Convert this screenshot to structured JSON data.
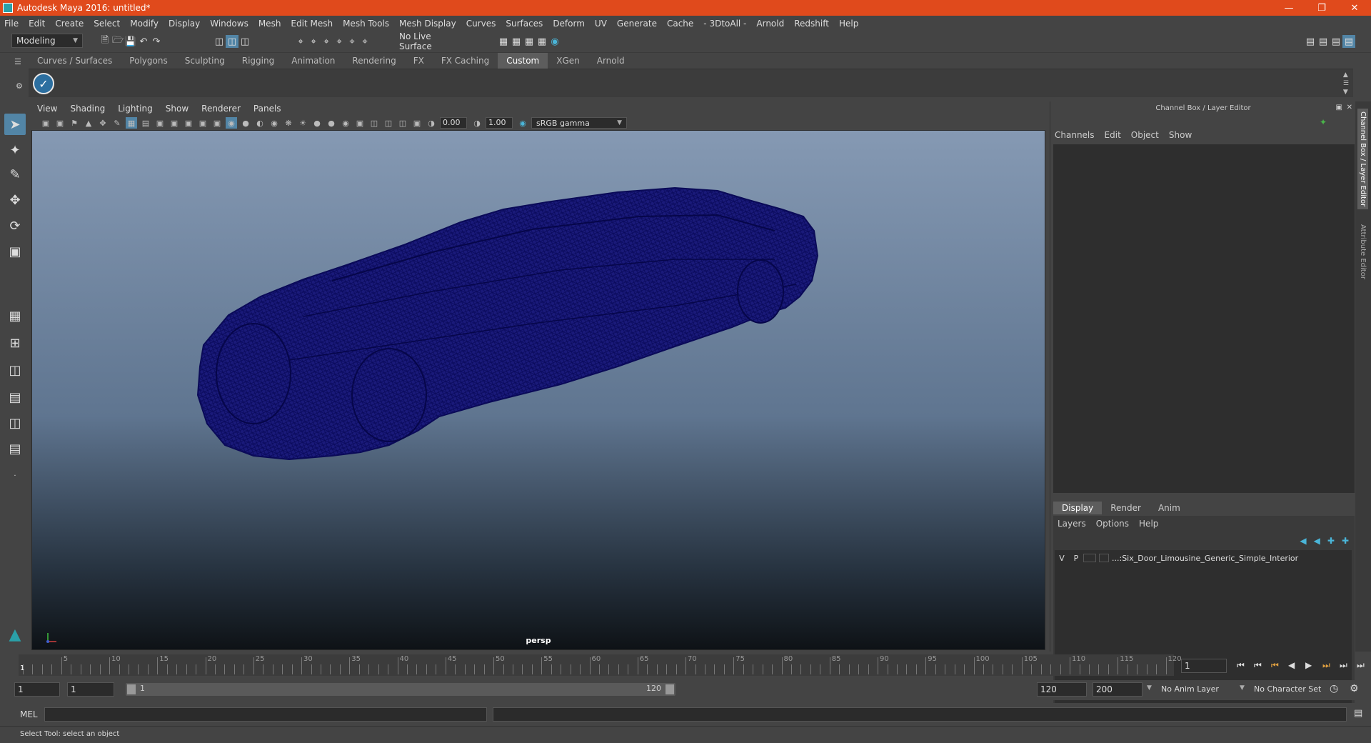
{
  "window": {
    "title": "Autodesk Maya 2016: untitled*"
  },
  "menu": [
    "File",
    "Edit",
    "Create",
    "Select",
    "Modify",
    "Display",
    "Windows",
    "Mesh",
    "Edit Mesh",
    "Mesh Tools",
    "Mesh Display",
    "Curves",
    "Surfaces",
    "Deform",
    "UV",
    "Generate",
    "Cache",
    "- 3DtoAll -",
    "Arnold",
    "Redshift",
    "Help"
  ],
  "status": {
    "mode": "Modeling",
    "live_surface": "No Live Surface"
  },
  "shelf_tabs": [
    "Curves / Surfaces",
    "Polygons",
    "Sculpting",
    "Rigging",
    "Animation",
    "Rendering",
    "FX",
    "FX Caching",
    "Custom",
    "XGen",
    "Arnold"
  ],
  "shelf_active": "Custom",
  "panel_menu": [
    "View",
    "Shading",
    "Lighting",
    "Show",
    "Renderer",
    "Panels"
  ],
  "panel_tools": {
    "exposure": "0.00",
    "gamma": "1.00",
    "color_space": "sRGB gamma"
  },
  "viewport": {
    "camera": "persp",
    "mesh_color": "#0d0d6e"
  },
  "channel_box": {
    "title": "Channel Box / Layer Editor",
    "menu": [
      "Channels",
      "Edit",
      "Object",
      "Show"
    ]
  },
  "layer_editor": {
    "tabs": [
      "Display",
      "Render",
      "Anim"
    ],
    "menu": [
      "Layers",
      "Options",
      "Help"
    ],
    "layer": {
      "v": "V",
      "p": "P",
      "name": "...:Six_Door_Limousine_Generic_Simple_Interior"
    }
  },
  "side_tabs": [
    "Channel Box / Layer Editor",
    "Attribute Editor"
  ],
  "timeline": {
    "ticks": [
      "5",
      "10",
      "15",
      "20",
      "25",
      "30",
      "35",
      "40",
      "45",
      "50",
      "55",
      "60",
      "65",
      "70",
      "75",
      "80",
      "85",
      "90",
      "95",
      "100",
      "105",
      "110",
      "115",
      "120"
    ],
    "start_label": "1",
    "current_frame": "1"
  },
  "range": {
    "start": "1",
    "start2": "1",
    "slider_start": "1",
    "slider_end": "120",
    "end": "120",
    "end2": "200",
    "anim_layer": "No Anim Layer",
    "char_set": "No Character Set"
  },
  "cmd": {
    "label": "MEL"
  },
  "help": {
    "text": "Select Tool: select an object"
  }
}
